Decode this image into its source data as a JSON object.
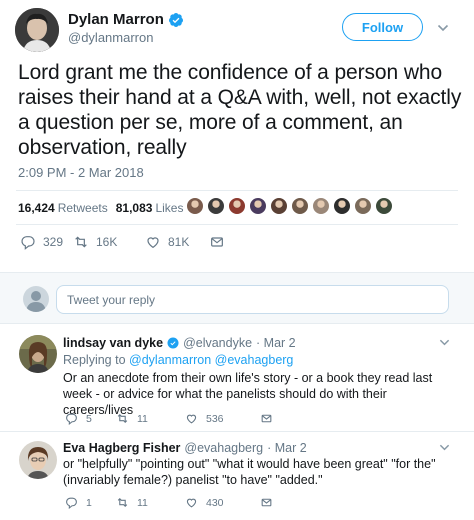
{
  "main_tweet": {
    "author_name": "Dylan Marron",
    "author_handle": "@dylanmarron",
    "follow_label": "Follow",
    "text": "Lord grant me the confidence of a person who raises their hand at a Q&A with, well, not exactly a question per se, more of a comment, an observation, really",
    "timestamp": "2:09 PM - 2 Mar 2018",
    "retweets_count": "16,424",
    "retweets_label": "Retweets",
    "likes_count": "81,083",
    "likes_label": "Likes",
    "liker_avatar_colors": [
      "#7a5b4c",
      "#3b3b3b",
      "#8c3a2f",
      "#4a3b5e",
      "#5a4034",
      "#6f5a4a",
      "#9a8778",
      "#2d2d2d",
      "#7a6a5a",
      "#3c4a3a"
    ],
    "actions": {
      "reply_count": "329",
      "retweet_count": "16K",
      "like_count": "81K"
    }
  },
  "reply_box": {
    "placeholder": "Tweet your reply"
  },
  "replies": [
    {
      "name": "lindsay van dyke",
      "handle": "@elvandyke",
      "date": "· Mar 2",
      "replying_to_label": "Replying to",
      "replying_to": "@dylanmarron @evahagberg",
      "text": "Or an anecdote from their own life's story - or a book they read last week - or advice for what the panelists should do with their careers/lives",
      "reply_count": "5",
      "retweet_count": "11",
      "like_count": "536"
    },
    {
      "name": "Eva Hagberg Fisher",
      "handle": "@evahagberg",
      "date": "· Mar 2",
      "text": "or \"helpfully\" \"pointing out\" \"what it would have been great\" \"for the\" (invariably female?) panelist \"to have\" \"added.\"",
      "reply_count": "1",
      "retweet_count": "11",
      "like_count": "430"
    }
  ],
  "colors": {
    "accent": "#1da1f2",
    "text": "#14171a",
    "secondary": "#657786",
    "border": "#e6ecf0"
  },
  "icons": {
    "verified": "verified-badge-icon",
    "caret": "chevron-down-icon",
    "reply": "reply-icon",
    "retweet": "retweet-icon",
    "like": "heart-icon",
    "dm": "envelope-icon"
  }
}
